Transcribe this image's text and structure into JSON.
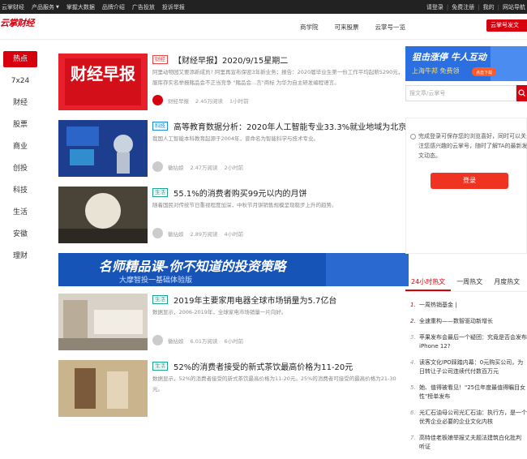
{
  "topbar": {
    "left": [
      "云掌财经",
      "产品服务",
      "掌握大数据",
      "品牌介绍",
      "广告投放",
      "投诉举报"
    ],
    "login": "请登录",
    "register": "免费注册",
    "mine": "我的",
    "sitemap": "网站导航"
  },
  "header": {
    "logo": "云掌财经",
    "links": [
      "商学院",
      "可来股票",
      "云掌号一览"
    ],
    "publish": "云掌号发文"
  },
  "sidebar": [
    "热点",
    "7x24",
    "财经",
    "股票",
    "商业",
    "创投",
    "科技",
    "生活",
    "安徽",
    "理财"
  ],
  "articles": [
    {
      "tag": "财经",
      "title": "【财经早报】2020/9/15星期二",
      "desc": "阿里动物园又要添新成员? 阿里再宣布保密3年新业务；报告：2020届毕业生第一份工作平均起薪5290元，服库存实名举报赌品会不正当竞争 \"赌品会...言\"商标 为华为自主研发编程语言。",
      "author": "财经早报",
      "views": "2.45万阅读",
      "time": "1小时前",
      "thumb_text": "财经早报"
    },
    {
      "tag": "科技",
      "title": "高等教育数据分析：2020年人工智能专业33.3%就业地域为北京",
      "desc": "我国人工智能本科教育起源于2004年，曾命名为智能科学与技术专业。",
      "author": "徽拈娘",
      "views": "2.47万阅读",
      "time": "2小时前"
    },
    {
      "tag": "生活",
      "title": "55.1%的消费者购买99元以内的月饼",
      "desc": "随着国民对传统节日重视程度加深，中秋节月饼销售规模呈现稳步上升的趋势。",
      "author": "徽拈娘",
      "views": "2.89万阅读",
      "time": "4小时前"
    },
    {
      "tag": "生活",
      "title": "2019年主要家用电器全球市场销量为5.7亿台",
      "desc": "数据显示，2006-2019年，全球家电市场销量一片向好。",
      "author": "徽拈娘",
      "views": "6.01万阅读",
      "time": "6小时前"
    },
    {
      "tag": "生活",
      "title": "52%的消费者接受的新式茶饮最高价格为11-20元",
      "desc": "数据显示，52%的消费者接受的新式茶饮最高价格为11-20元。25%的消费者可接受的最高价格为21-30元。",
      "author": "",
      "views": "",
      "time": ""
    }
  ],
  "banner": {
    "title": "名师精品课-你不知道的投资策略",
    "subtitle": "大摩智投一基础体验版"
  },
  "right": {
    "ad_title": "狙击涨停 牛人互动",
    "ad_sub": "上海牛邦 免费领",
    "ad_btn": "点击下载",
    "search_placeholder": "搜文章/云掌号",
    "login_text": "完成登录可保存您的浏览喜好，同时可以关注您感兴趣的云掌号，随时了解TA的最新发文动态。",
    "login_btn": "登录",
    "tabs": [
      "24小时热文",
      "一周热文",
      "月度热文"
    ],
    "hot": [
      "一周热销基金 |",
      "全速重构——数智驱动新增长",
      "苹果发布会最后一个疑团：究竟是否会发布iPhone 12?",
      "读客文化IPO踩踏内幕：0元购买公司，为日转让子公司连续代付数百万元",
      "她、值得被看见！\"25位年度最值得瞩目女性\"榜单发布",
      "光汇石油母公司光汇石油：执行方，是一个优秀企业必要的企业文化内核",
      "高特佳老板娘举报丈夫题法建筑白化批判 听证"
    ]
  },
  "colors": {
    "brand": "#d7000f",
    "topbar": "#222222"
  }
}
